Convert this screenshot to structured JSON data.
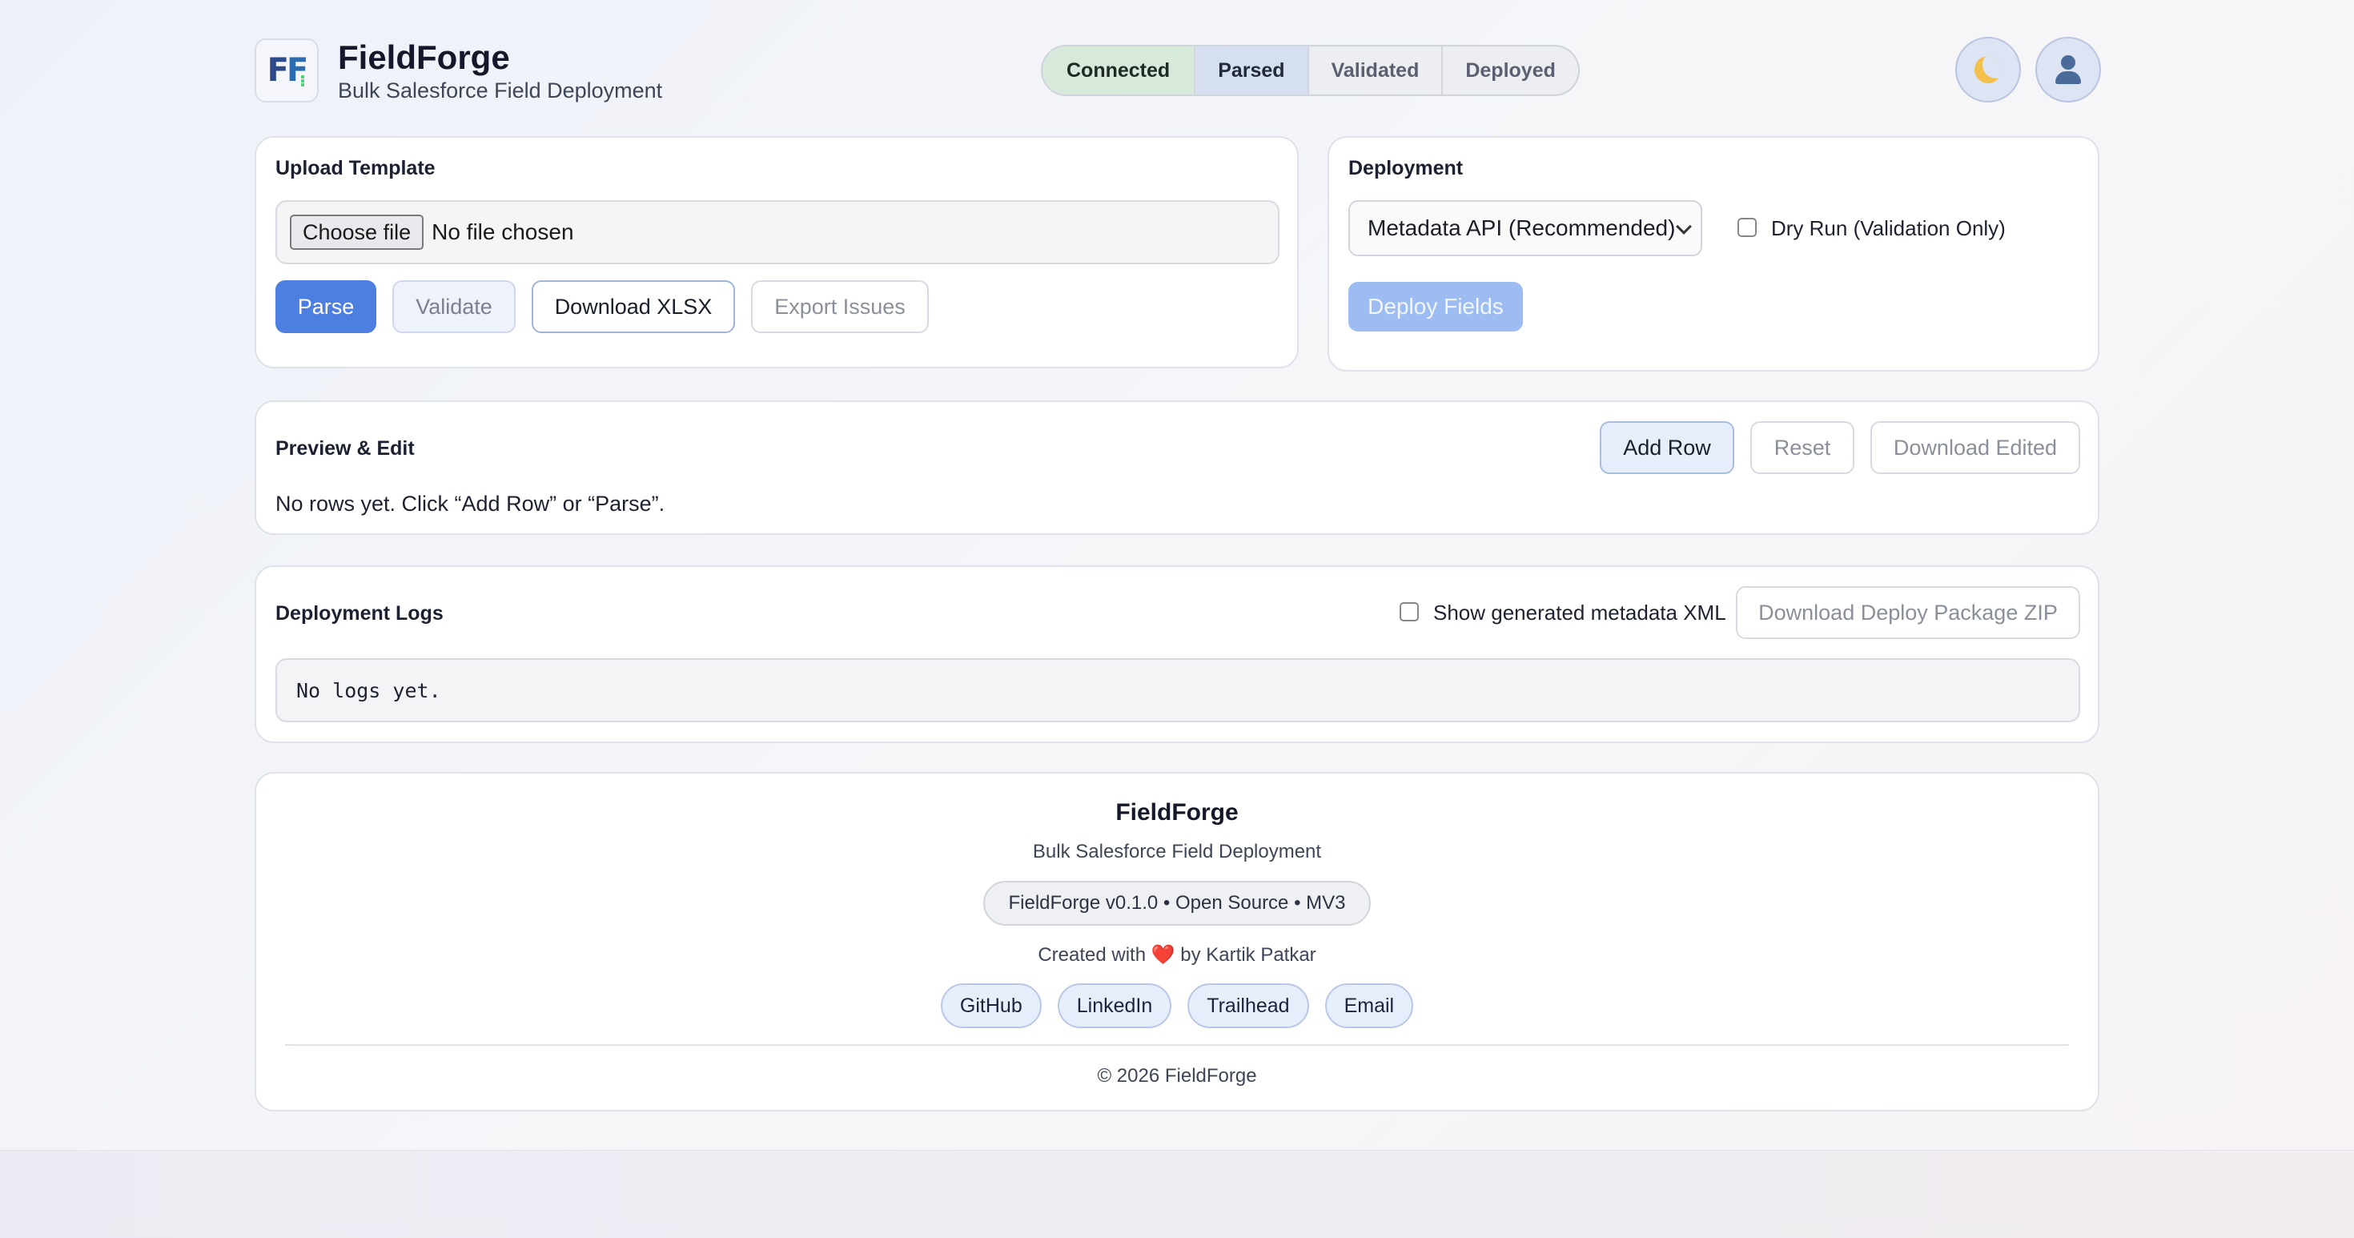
{
  "header": {
    "logo_text_1": "F",
    "logo_text_2": "F",
    "title": "FieldForge",
    "subtitle": "Bulk Salesforce Field Deployment",
    "steps": [
      {
        "label": "Connected"
      },
      {
        "label": "Parsed"
      },
      {
        "label": "Validated"
      },
      {
        "label": "Deployed"
      }
    ],
    "active_step": "Parsed",
    "theme_toggle_icon": "moon-icon",
    "account_icon": "user-icon"
  },
  "upload": {
    "title": "Upload Template",
    "choose_file_label": "Choose file",
    "file_status": "No file chosen",
    "parse_label": "Parse",
    "validate_label": "Validate",
    "download_xlsx_label": "Download XLSX",
    "export_issues_label": "Export Issues"
  },
  "deployment": {
    "title": "Deployment",
    "method_selected": "Metadata API (Recommended)",
    "dry_run_label": "Dry Run (Validation Only)",
    "dry_run_checked": false,
    "deploy_label": "Deploy Fields"
  },
  "preview": {
    "title": "Preview & Edit",
    "add_row_label": "Add Row",
    "reset_label": "Reset",
    "download_edited_label": "Download Edited",
    "empty_message": "No rows yet. Click “Add Row” or “Parse”."
  },
  "logs": {
    "title": "Deployment Logs",
    "show_xml_label": "Show generated metadata XML",
    "show_xml_checked": false,
    "download_zip_label": "Download Deploy Package ZIP",
    "content": "No logs yet."
  },
  "footer": {
    "title": "FieldForge",
    "subtitle": "Bulk Salesforce Field Deployment",
    "version": "FieldForge v0.1.0 • Open Source • MV3",
    "created_prefix": "Created with",
    "heart": "❤️",
    "created_suffix": "by Kartik Patkar",
    "links": [
      "GitHub",
      "LinkedIn",
      "Trailhead",
      "Email"
    ],
    "copyright": "© 2026 FieldForge"
  },
  "colors": {
    "primary": "#4d7fe0",
    "connected_step_bg": "#d6e9db",
    "active_step_bg": "#d5dff0",
    "deploy_disabled": "#9dbdf2"
  }
}
